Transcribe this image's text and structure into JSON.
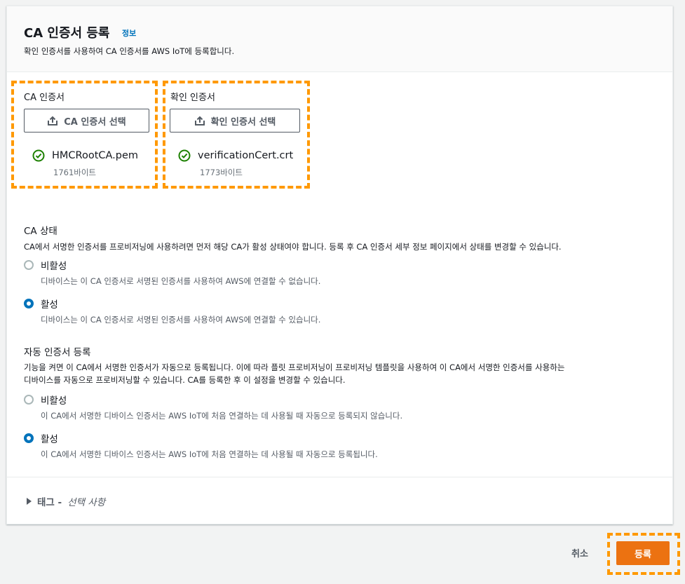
{
  "header": {
    "title": "CA 인증서 등록",
    "info_link": "정보",
    "description": "확인 인증서를 사용하여 CA 인증서를 AWS IoT에 등록합니다."
  },
  "ca_certificate": {
    "label": "CA 인증서",
    "button_label": "CA 인증서 선택",
    "file_name": "HMCRootCA.pem",
    "file_size": "1761바이트"
  },
  "verification_certificate": {
    "label": "확인 인증서",
    "button_label": "확인 인증서 선택",
    "file_name": "verificationCert.crt",
    "file_size": "1773바이트"
  },
  "ca_status": {
    "title": "CA 상태",
    "description": "CA에서 서명한 인증서를 프로비저닝에 사용하려면 먼저 해당 CA가 활성 상태여야 합니다. 등록 후 CA 인증서 세부 정보 페이지에서 상태를 변경할 수 있습니다.",
    "options": [
      {
        "label": "비활성",
        "description": "디바이스는 이 CA 인증서로 서명된 인증서를 사용하여 AWS에 연결할 수 없습니다.",
        "selected": false
      },
      {
        "label": "활성",
        "description": "디바이스는 이 CA 인증서로 서명된 인증서를 사용하여 AWS에 연결할 수 있습니다.",
        "selected": true
      }
    ]
  },
  "auto_registration": {
    "title": "자동 인증서 등록",
    "description_line1": "기능을 켜면 이 CA에서 서명한 인증서가 자동으로 등록됩니다. 이에 따라 플릿 프로비저닝이 프로비저닝 템플릿을 사용하여 이 CA에서 서명한 인증서를 사용하는",
    "description_line2": "디바이스를 자동으로 프로비저닝할 수 있습니다. CA를 등록한 후 이 설정을 변경할 수 있습니다.",
    "options": [
      {
        "label": "비활성",
        "description": "이 CA에서 서명한 디바이스 인증서는 AWS IoT에 처음 연결하는 데 사용될 때 자동으로 등록되지 않습니다.",
        "selected": false
      },
      {
        "label": "활성",
        "description": "이 CA에서 서명한 디바이스 인증서는 AWS IoT에 처음 연결하는 데 사용될 때 자동으로 등록됩니다.",
        "selected": true
      }
    ]
  },
  "tags": {
    "label": "태그 -",
    "optional": "선택 사항"
  },
  "footer": {
    "cancel_label": "취소",
    "submit_label": "등록"
  },
  "colors": {
    "accent": "#0073bb",
    "primary_button": "#ec7211",
    "highlight": "#ff9900",
    "success": "#1d8102"
  }
}
